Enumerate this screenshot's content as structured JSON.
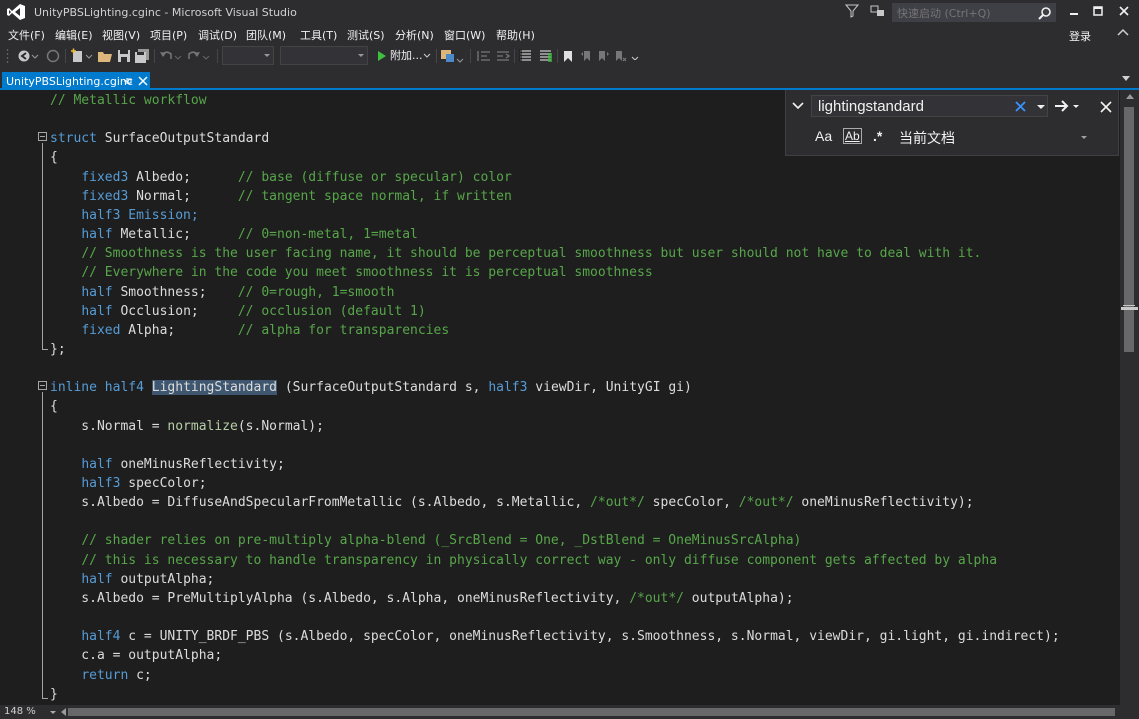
{
  "window": {
    "title": "UnityPBSLighting.cginc - Microsoft Visual Studio",
    "quick_launch_placeholder": "快速启动 (Ctrl+Q)",
    "login_label": "登录"
  },
  "menu": [
    "文件(F)",
    "编辑(E)",
    "视图(V)",
    "项目(P)",
    "调试(D)",
    "团队(M)",
    "工具(T)",
    "测试(S)",
    "分析(N)",
    "窗口(W)",
    "帮助(H)"
  ],
  "toolbar": {
    "attach_label": "附加...",
    "config_combo": "",
    "platform_combo": ""
  },
  "tab": {
    "label": "UnityPBSLighting.cginc"
  },
  "find": {
    "query": "lightingstandard",
    "match_case_label": "Aa",
    "whole_word_label": "Ab",
    "regex_label": ".*",
    "scope": "当前文档"
  },
  "status": {
    "zoom": "148 %"
  },
  "colors": {
    "accent": "#007acc",
    "keyword": "#569cd6",
    "comment": "#57a64a",
    "function": "#b5cea8",
    "text": "#dcdcdc",
    "editor_bg": "#1e1e1e",
    "highlight": "#3e566f"
  },
  "code": [
    [
      {
        "t": "// Metallic workflow",
        "c": "cm"
      }
    ],
    [],
    [
      {
        "t": "struct",
        "c": "kw"
      },
      {
        "t": " SurfaceOutputStandard"
      }
    ],
    [
      {
        "t": "{"
      }
    ],
    [
      {
        "t": "    "
      },
      {
        "t": "fixed3",
        "c": "kw"
      },
      {
        "t": " Albedo;      "
      },
      {
        "t": "// base (diffuse or specular) color",
        "c": "cm"
      }
    ],
    [
      {
        "t": "    "
      },
      {
        "t": "fixed3",
        "c": "kw"
      },
      {
        "t": " Normal;      "
      },
      {
        "t": "// tangent space normal, if written",
        "c": "cm"
      }
    ],
    [
      {
        "t": "    "
      },
      {
        "t": "half3 Emission;",
        "c": "kw"
      }
    ],
    [
      {
        "t": "    "
      },
      {
        "t": "half",
        "c": "kw"
      },
      {
        "t": " Metallic;      "
      },
      {
        "t": "// 0=non-metal, 1=metal",
        "c": "cm"
      }
    ],
    [
      {
        "t": "    "
      },
      {
        "t": "// Smoothness is the user facing name, it should be perceptual smoothness but user should not have to deal with it.",
        "c": "cm"
      }
    ],
    [
      {
        "t": "    "
      },
      {
        "t": "// Everywhere in the code you meet smoothness it is perceptual smoothness",
        "c": "cm"
      }
    ],
    [
      {
        "t": "    "
      },
      {
        "t": "half",
        "c": "kw"
      },
      {
        "t": " Smoothness;    "
      },
      {
        "t": "// 0=rough, 1=smooth",
        "c": "cm"
      }
    ],
    [
      {
        "t": "    "
      },
      {
        "t": "half",
        "c": "kw"
      },
      {
        "t": " Occlusion;     "
      },
      {
        "t": "// occlusion (default 1)",
        "c": "cm"
      }
    ],
    [
      {
        "t": "    "
      },
      {
        "t": "fixed",
        "c": "kw"
      },
      {
        "t": " Alpha;        "
      },
      {
        "t": "// alpha for transparencies",
        "c": "cm"
      }
    ],
    [
      {
        "t": "};"
      }
    ],
    [],
    [
      {
        "t": "inline",
        "c": "kw"
      },
      {
        "t": " "
      },
      {
        "t": "half4",
        "c": "kw"
      },
      {
        "t": " "
      },
      {
        "t": "LightingStandard",
        "c": "hl"
      },
      {
        "t": " (SurfaceOutputStandard s, "
      },
      {
        "t": "half3",
        "c": "kw"
      },
      {
        "t": " viewDir, UnityGI gi)"
      }
    ],
    [
      {
        "t": "{"
      }
    ],
    [
      {
        "t": "    s.Normal = "
      },
      {
        "t": "normalize",
        "c": "fn"
      },
      {
        "t": "(s.Normal);"
      }
    ],
    [],
    [
      {
        "t": "    "
      },
      {
        "t": "half",
        "c": "kw"
      },
      {
        "t": " oneMinusReflectivity;"
      }
    ],
    [
      {
        "t": "    "
      },
      {
        "t": "half3",
        "c": "kw"
      },
      {
        "t": " specColor;"
      }
    ],
    [
      {
        "t": "    s.Albedo = DiffuseAndSpecularFromMetallic (s.Albedo, s.Metallic, "
      },
      {
        "t": "/*out*/",
        "c": "cm"
      },
      {
        "t": " specColor, "
      },
      {
        "t": "/*out*/",
        "c": "cm"
      },
      {
        "t": " oneMinusReflectivity);"
      }
    ],
    [],
    [
      {
        "t": "    "
      },
      {
        "t": "// shader relies on pre-multiply alpha-blend (_SrcBlend = One, _DstBlend = OneMinusSrcAlpha)",
        "c": "cm"
      }
    ],
    [
      {
        "t": "    "
      },
      {
        "t": "// this is necessary to handle transparency in physically correct way - only diffuse component gets affected by alpha",
        "c": "cm"
      }
    ],
    [
      {
        "t": "    "
      },
      {
        "t": "half",
        "c": "kw"
      },
      {
        "t": " outputAlpha;"
      }
    ],
    [
      {
        "t": "    s.Albedo = PreMultiplyAlpha (s.Albedo, s.Alpha, oneMinusReflectivity, "
      },
      {
        "t": "/*out*/",
        "c": "cm"
      },
      {
        "t": " outputAlpha);"
      }
    ],
    [],
    [
      {
        "t": "    "
      },
      {
        "t": "half4",
        "c": "kw"
      },
      {
        "t": " c = UNITY_BRDF_PBS (s.Albedo, specColor, oneMinusReflectivity, s.Smoothness, s.Normal, viewDir, gi.light, gi.indirect);"
      }
    ],
    [
      {
        "t": "    c.a = outputAlpha;"
      }
    ],
    [
      {
        "t": "    "
      },
      {
        "t": "return",
        "c": "kw"
      },
      {
        "t": " c;"
      }
    ],
    [
      {
        "t": "}"
      }
    ]
  ]
}
